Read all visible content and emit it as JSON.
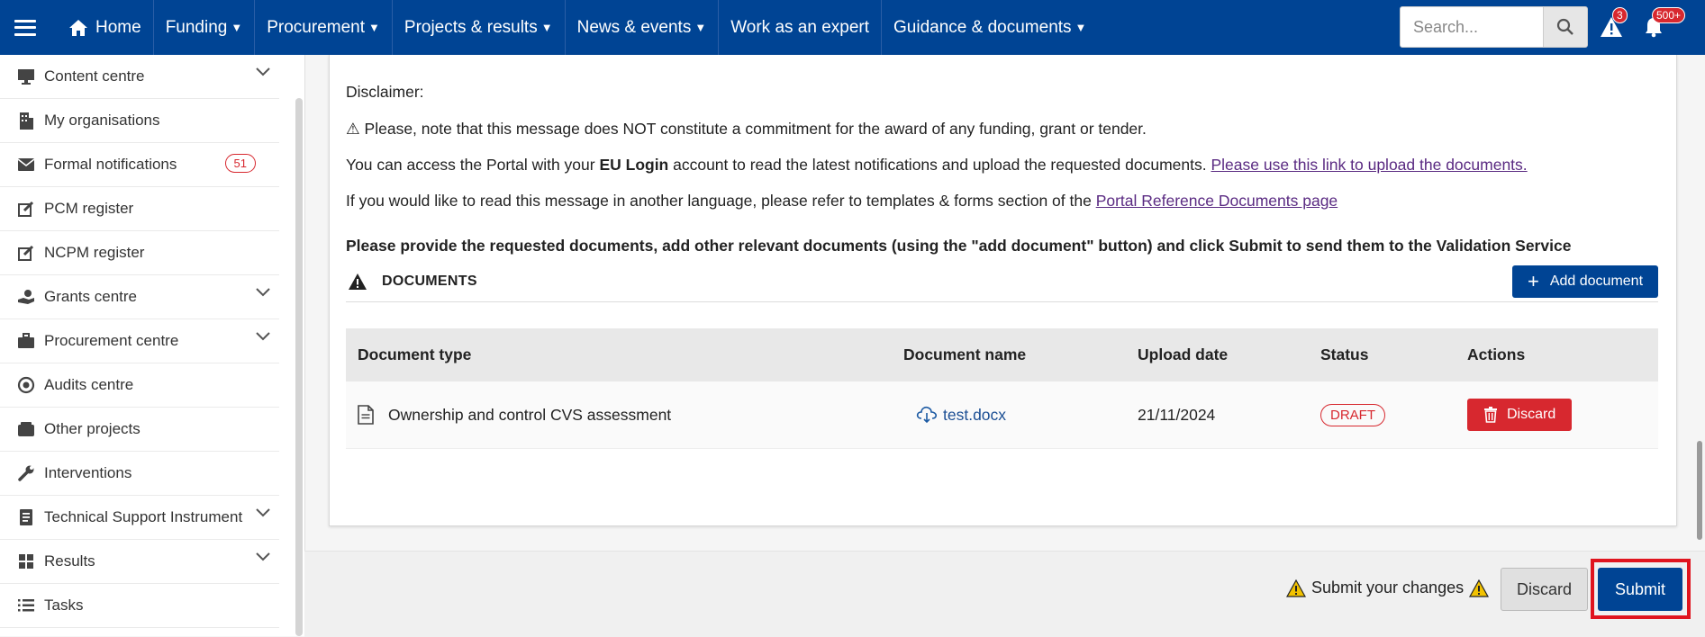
{
  "nav": {
    "items": [
      {
        "label": "Home"
      },
      {
        "label": "Funding"
      },
      {
        "label": "Procurement"
      },
      {
        "label": "Projects & results"
      },
      {
        "label": "News & events"
      },
      {
        "label": "Work as an expert"
      },
      {
        "label": "Guidance & documents"
      }
    ],
    "search_placeholder": "Search...",
    "alerts_badge": "3",
    "notifications_badge": "500+"
  },
  "sidebar": {
    "items": [
      {
        "label": "Content centre"
      },
      {
        "label": "My organisations"
      },
      {
        "label": "Formal notifications",
        "count": "51"
      },
      {
        "label": "PCM register"
      },
      {
        "label": "NCPM register"
      },
      {
        "label": "Grants centre"
      },
      {
        "label": "Procurement centre"
      },
      {
        "label": "Audits centre"
      },
      {
        "label": "Other projects"
      },
      {
        "label": "Interventions"
      },
      {
        "label": "Technical Support Instrument"
      },
      {
        "label": "Results"
      },
      {
        "label": "Tasks"
      }
    ]
  },
  "message": {
    "disclaimer": "Disclaimer:",
    "note": "⚠ Please, note that this message does NOT constitute a commitment for the award of any funding, grant or tender.",
    "access_pre": "You can access the Portal with your ",
    "access_bold": "EU Login",
    "access_post": " account to read the latest notifications and upload the requested documents. ",
    "access_link": "Please use this link to upload the documents.",
    "language_pre": "If you would like to read this message in another language, please refer to templates & forms section of the ",
    "language_link": "Portal Reference Documents page",
    "instruction": "Please provide the requested documents, add other relevant documents (using the \"add document\" button) and click Submit to send them to the Validation Service"
  },
  "documents": {
    "title": "DOCUMENTS",
    "add_button": "Add document",
    "columns": {
      "type": "Document type",
      "name": "Document name",
      "date": "Upload date",
      "status": "Status",
      "actions": "Actions"
    },
    "rows": [
      {
        "type": "Ownership and control CVS assessment",
        "name": "test.docx",
        "date": "21/11/2024",
        "status": "DRAFT",
        "action": "Discard"
      }
    ]
  },
  "footer": {
    "submit_note": "Submit your changes",
    "discard_label": "Discard",
    "submit_label": "Submit"
  }
}
